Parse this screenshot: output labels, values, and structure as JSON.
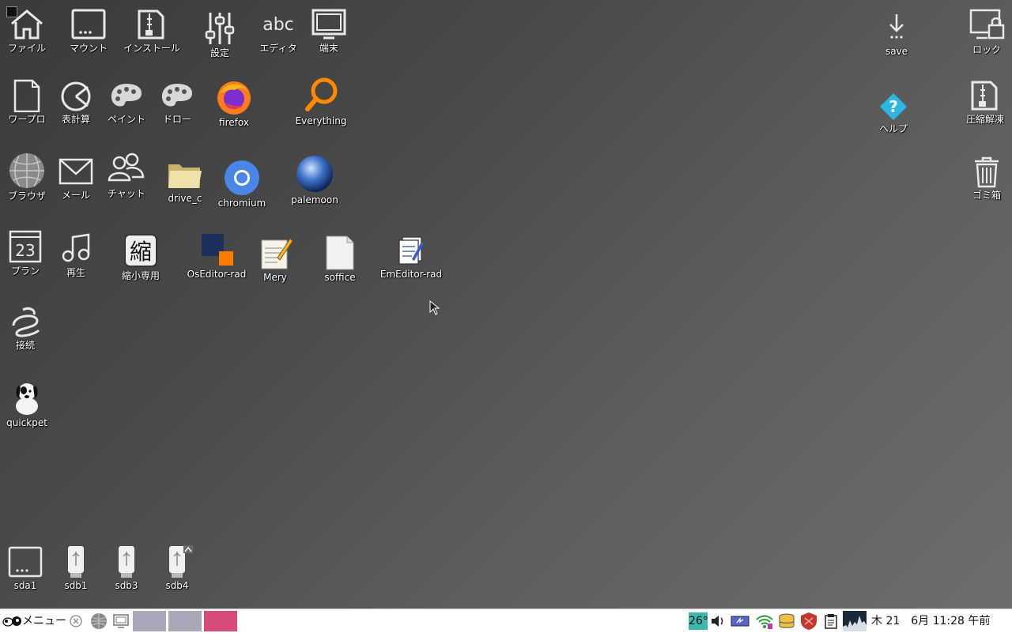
{
  "desktop": {
    "icons": {
      "file": "ファイル",
      "mount": "マウント",
      "install": "インストール",
      "settings": "設定",
      "editor": "エディタ",
      "terminal": "端末",
      "wordpro": "ワープロ",
      "spreadsheet": "表計算",
      "paint": "ペイント",
      "draw": "ドロー",
      "firefox": "firefox",
      "everything": "Everything",
      "browser": "ブラウザ",
      "mail": "メール",
      "chat": "チャット",
      "drive_c": "drive_c",
      "chromium": "chromium",
      "palemoon": "palemoon",
      "plan": "プラン",
      "calendar_day": "23",
      "play": "再生",
      "shrink": "縮小専用",
      "shrink_glyph": "縮",
      "oseditor": "OsEditor-rad",
      "mery": "Mery",
      "soffice": "soffice",
      "emeditor": "EmEditor-rad",
      "connect": "接続",
      "quickpet": "quickpet",
      "save": "save",
      "lock": "ロック",
      "help": "ヘルプ",
      "decompress": "圧縮解凍",
      "trash": "ゴミ箱",
      "sda1": "sda1",
      "sdb1": "sdb1",
      "sdb3": "sdb3",
      "sdb4": "sdb4"
    }
  },
  "taskbar": {
    "menu_label": "メニュー",
    "temperature": "26°",
    "clock": "木 21　6月 11:28 午前",
    "colors": {
      "window_btn": "#a8a8b8",
      "active_btn": "#d84a7a",
      "temp_bg": "#3bb8b0"
    }
  }
}
